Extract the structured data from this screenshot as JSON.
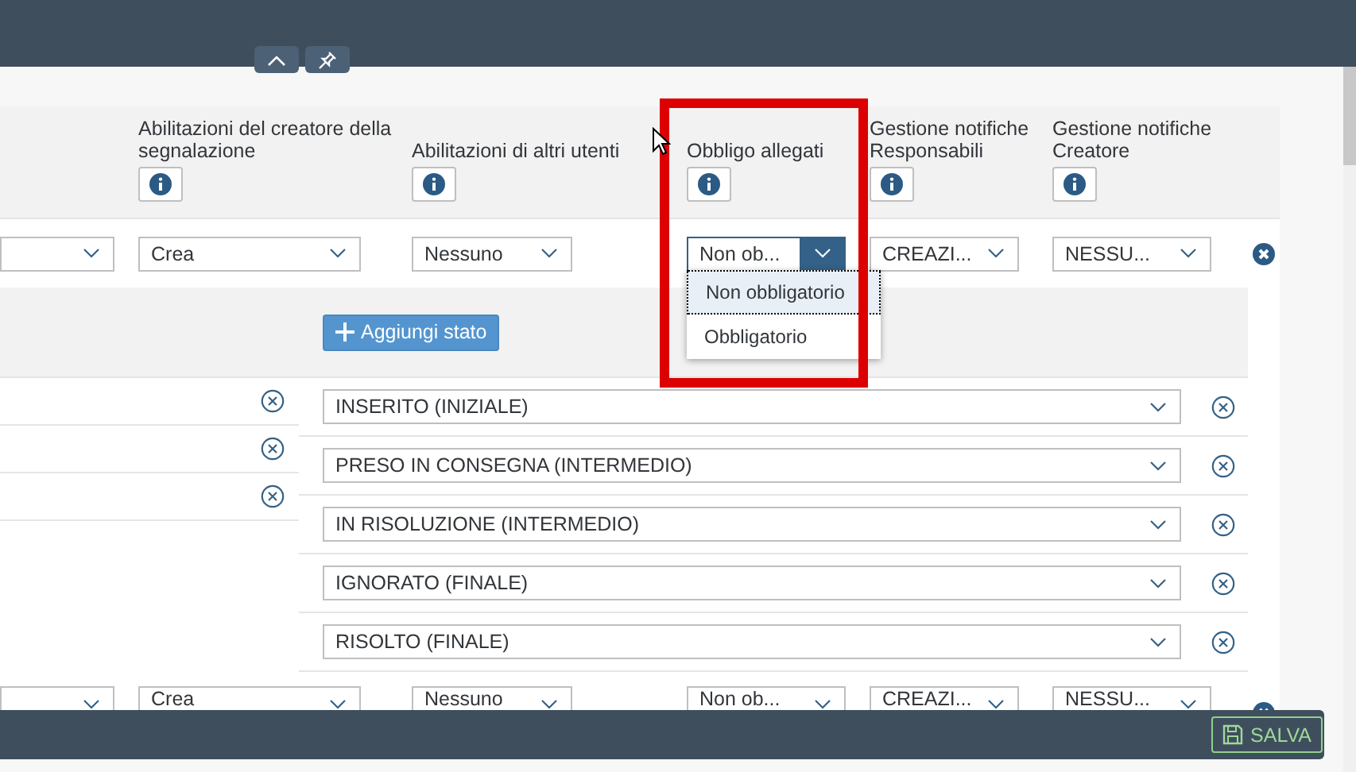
{
  "columns": [
    {
      "label": "Abilitazioni del creatore della segnalazione",
      "info": true
    },
    {
      "label": "Abilitazioni di altri utenti",
      "info": true
    },
    {
      "label": "Obbligo allegati",
      "info": true
    },
    {
      "label": "Gestione notifiche Responsabili",
      "info": true
    },
    {
      "label": "Gestione notifiche Creatore",
      "info": true
    }
  ],
  "rows": [
    {
      "cells": [
        {
          "kind": "select",
          "open": false
        },
        {
          "kind": "select",
          "value": "Crea",
          "open": false
        },
        {
          "kind": "select",
          "value": "Nessuno",
          "open": false
        },
        {
          "kind": "select",
          "value": "Non ob...",
          "open": true
        },
        {
          "kind": "select",
          "value": "CREAZI...",
          "open": false
        },
        {
          "kind": "select",
          "value": "NESSU...",
          "open": false
        }
      ]
    },
    {
      "cells": [
        {
          "kind": "select",
          "open": false
        },
        {
          "kind": "select",
          "value": "Crea",
          "open": false
        },
        {
          "kind": "select",
          "value": "Nessuno",
          "open": false
        },
        {
          "kind": "select",
          "value": "Non ob...",
          "open": false
        },
        {
          "kind": "select",
          "value": "CREAZI...",
          "open": false
        },
        {
          "kind": "select",
          "value": "NESSU...",
          "open": false
        }
      ]
    }
  ],
  "dropdown_options": [
    {
      "label": "Non obbligatorio",
      "selected": true
    },
    {
      "label": "Obbligatorio",
      "selected": false
    }
  ],
  "add_state_button": "Aggiungi stato",
  "left_items": [
    {
      "kind": "removable"
    },
    {
      "kind": "removable"
    },
    {
      "kind": "removable"
    }
  ],
  "states": [
    "INSERITO (INIZIALE)",
    "PRESO IN CONSEGNA (INTERMEDIO)",
    "IN RISOLUZIONE (INTERMEDIO)",
    "IGNORATO (FINALE)",
    "RISOLTO (FINALE)"
  ],
  "save_button": "SALVA"
}
